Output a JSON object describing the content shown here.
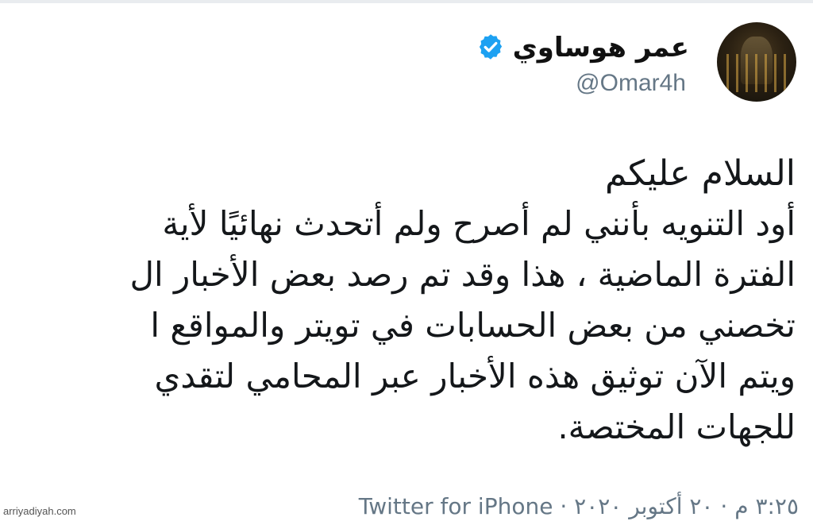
{
  "author": {
    "display_name": "عمر هوساوي",
    "handle": "@Omar4h",
    "verified": true,
    "avatar_icon": "profile-photo"
  },
  "tweet": {
    "lines": [
      "السلام عليكم",
      "أود التنويه بأنني لم أصرح ولم أتحدث نهائيًا لأية",
      "الفترة الماضية ، هذا وقد تم رصد بعض الأخبار ال",
      "تخصني من بعض الحسابات في تويتر والمواقع ا",
      "ويتم الآن توثيق هذه الأخبار عبر المحامي لتقدي",
      "للجهات المختصة."
    ]
  },
  "meta": {
    "time": "٣:٢٥ م",
    "separator": "·",
    "date": "٢٠ أكتوبر ٢٠٢٠",
    "source": "Twitter for iPhone"
  },
  "watermark": "arriyadiyah.com",
  "colors": {
    "verified_blue": "#1DA1F2",
    "secondary_text": "#657786",
    "primary_text": "#14171A"
  }
}
